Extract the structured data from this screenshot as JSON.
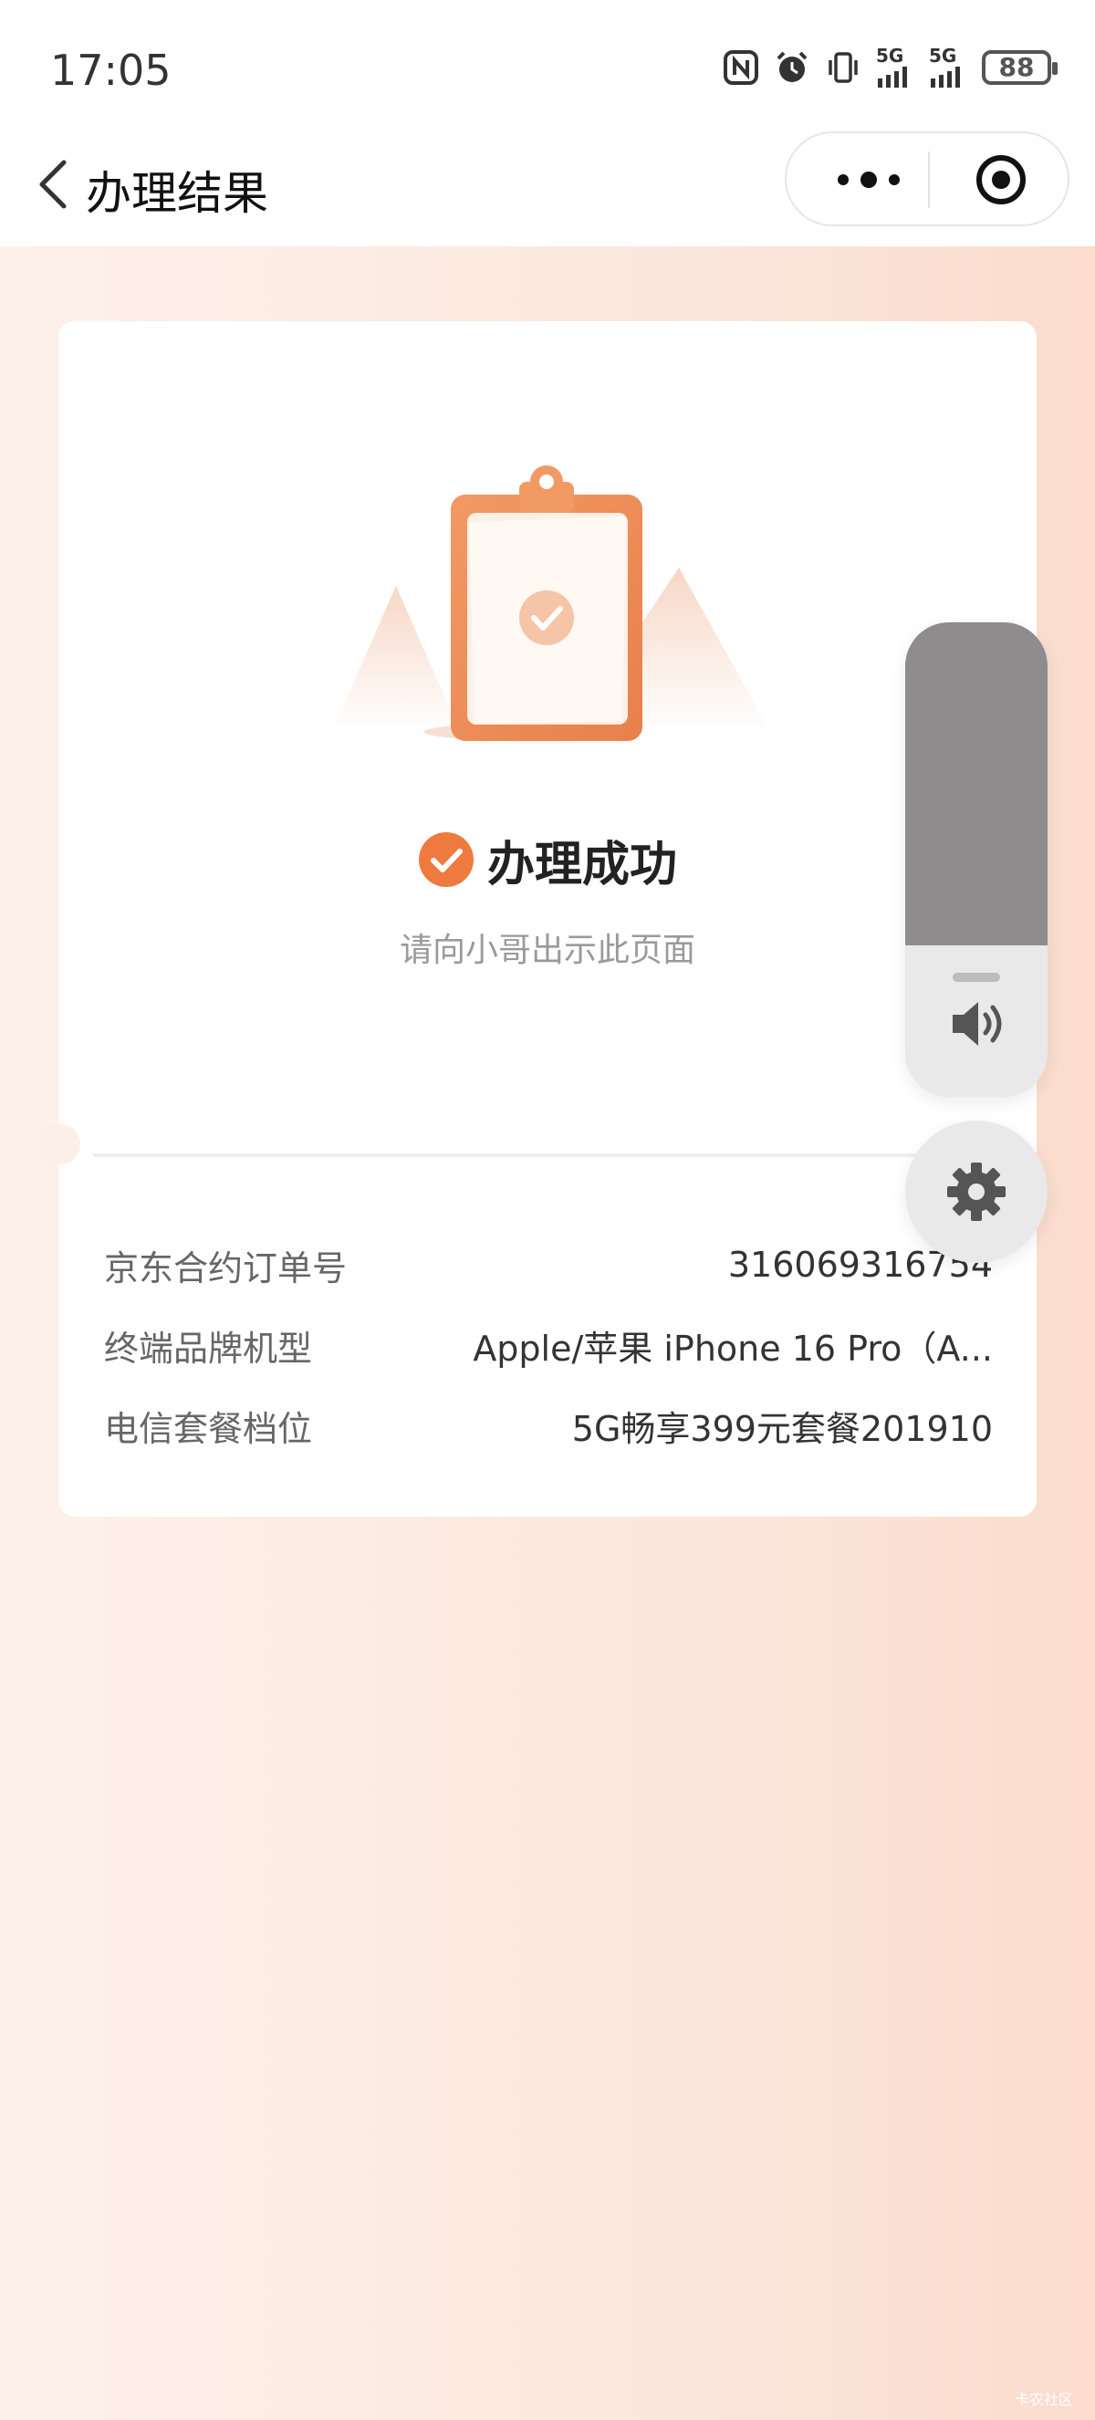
{
  "status_bar": {
    "time": "17:05",
    "signal_1": "5G",
    "signal_2": "5G",
    "battery": "88",
    "icons": [
      "nfc-icon",
      "alarm-icon",
      "vibrate-icon",
      "signal-icon",
      "signal-icon",
      "battery-icon"
    ]
  },
  "nav": {
    "title": "办理结果",
    "back_icon": "chevron-left-icon",
    "more_icon": "more-dots-icon",
    "close_icon": "target-icon"
  },
  "result": {
    "status": "办理成功",
    "hint": "请向小哥出示此页面",
    "accent_color": "#ee7a3f"
  },
  "details": [
    {
      "label": "京东合约订单号",
      "value": "316069316754"
    },
    {
      "label": "终端品牌机型",
      "value": "Apple/苹果 iPhone 16 Pro（A..."
    },
    {
      "label": "电信套餐档位",
      "value": "5G畅享399元套餐201910"
    }
  ],
  "overlay": {
    "volume_level": 0.68,
    "volume_icon": "speaker-icon",
    "settings_icon": "gear-icon"
  },
  "watermark": "卡农社区"
}
